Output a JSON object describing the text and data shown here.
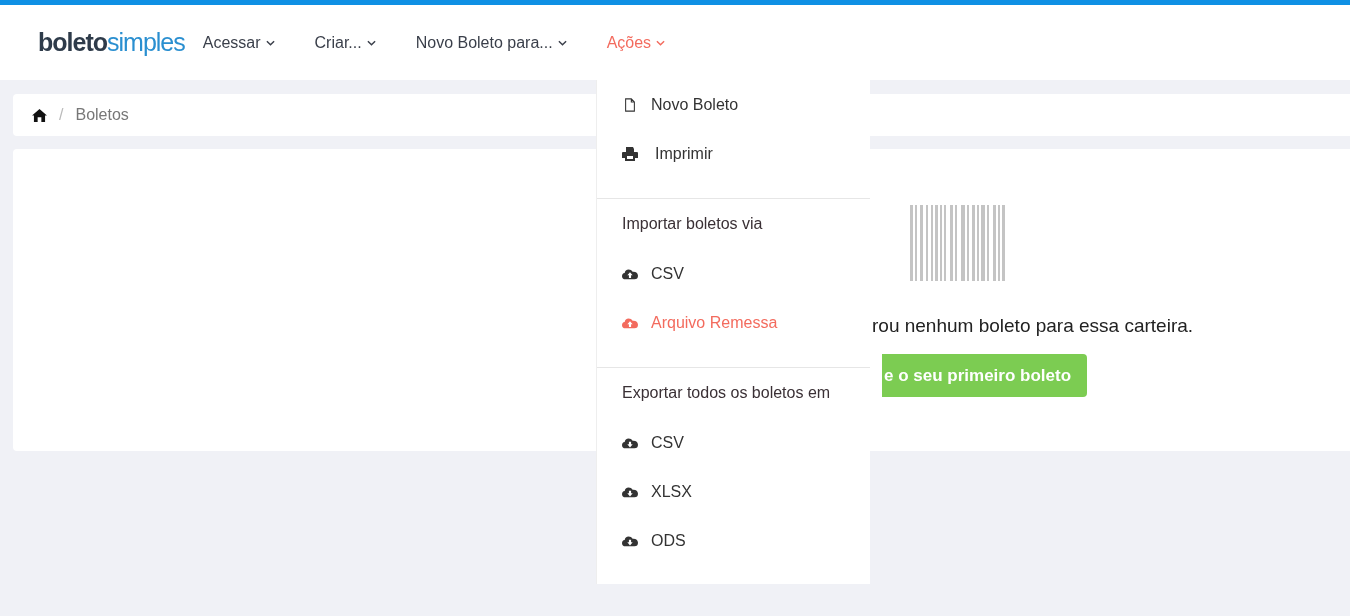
{
  "logo": {
    "part_1": "boleto",
    "part_2": "simples"
  },
  "nav": [
    {
      "label": "Acessar",
      "selected": false
    },
    {
      "label": "Criar...",
      "selected": false
    },
    {
      "label": "Novo Boleto para...",
      "selected": false
    },
    {
      "label": "Ações",
      "selected": true
    }
  ],
  "breadcrumb": {
    "separator": "/",
    "current": "Boletos"
  },
  "empty_state": {
    "message": "rou nenhum boleto para essa carteira.",
    "button": "e o seu primeiro boleto"
  },
  "menu": [
    {
      "kind": "document",
      "label": "Novo Boleto",
      "selected": false
    },
    {
      "kind": "printer",
      "label": "Imprimir",
      "selected": false
    },
    {
      "kind": "divider"
    },
    {
      "kind": "header",
      "label": "Importar boletos via"
    },
    {
      "kind": "upload",
      "label": "CSV",
      "selected": false
    },
    {
      "kind": "upload",
      "label": "Arquivo Remessa",
      "selected": true
    },
    {
      "kind": "divider"
    },
    {
      "kind": "header",
      "label": "Exportar todos os boletos em"
    },
    {
      "kind": "download",
      "label": "CSV",
      "selected": false
    },
    {
      "kind": "download",
      "label": "XLSX",
      "selected": false
    },
    {
      "kind": "download",
      "label": "ODS",
      "selected": false
    }
  ]
}
